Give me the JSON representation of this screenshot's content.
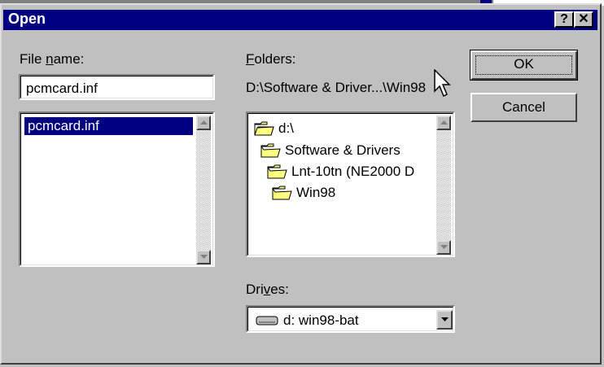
{
  "dialog": {
    "title": "Open",
    "help_glyph": "?",
    "close_glyph": "✕"
  },
  "file_name": {
    "label_pre": "File ",
    "label_accel": "n",
    "label_post": "ame:",
    "value": "pcmcard.inf",
    "list": [
      "pcmcard.inf"
    ]
  },
  "folders": {
    "label_accel": "F",
    "label_post": "olders:",
    "current_path": "D:\\Software & Driver...\\Win98",
    "tree": [
      {
        "label": "d:\\",
        "icon": "open-folder-icon"
      },
      {
        "label": "Software & Drivers",
        "icon": "open-folder-icon"
      },
      {
        "label": "Lnt-10tn (NE2000 D",
        "icon": "open-folder-icon"
      },
      {
        "label": "Win98",
        "icon": "open-folder-icon"
      }
    ]
  },
  "drives": {
    "label_pre": "Dri",
    "label_accel": "v",
    "label_post": "es:",
    "selected": "d: win98-bat",
    "icon": "drive-icon"
  },
  "buttons": {
    "ok": "OK",
    "cancel": "Cancel"
  },
  "colors": {
    "titlebar": "#000080",
    "selection": "#000080",
    "face": "#c0c0c0"
  }
}
